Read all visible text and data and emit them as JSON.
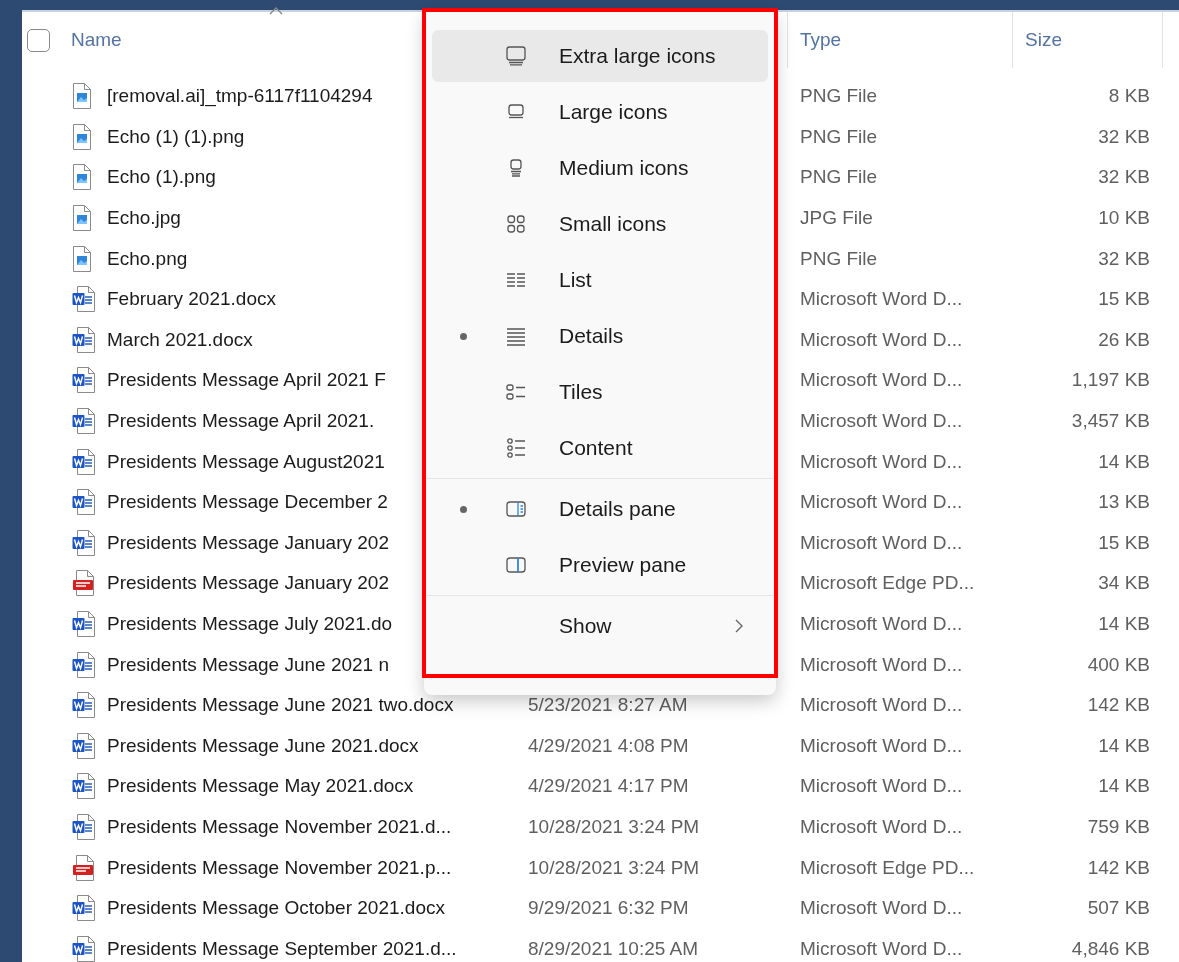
{
  "select_all": {
    "checked": false
  },
  "columns": [
    {
      "label": "Name",
      "sorted": true
    },
    {
      "label": "Type",
      "sorted": false
    },
    {
      "label": "Size",
      "sorted": false
    }
  ],
  "files": [
    {
      "name": "[removal.ai]_tmp-6117f1104294",
      "kind": "image",
      "type": "PNG File",
      "size": "8 KB"
    },
    {
      "name": "Echo (1) (1).png",
      "kind": "image",
      "type": "PNG File",
      "size": "32 KB"
    },
    {
      "name": "Echo (1).png",
      "kind": "image",
      "type": "PNG File",
      "size": "32 KB"
    },
    {
      "name": "Echo.jpg",
      "kind": "image",
      "type": "JPG File",
      "size": "10 KB"
    },
    {
      "name": "Echo.png",
      "kind": "image",
      "type": "PNG File",
      "size": "32 KB"
    },
    {
      "name": "February 2021.docx",
      "kind": "word",
      "type": "Microsoft Word D...",
      "size": "15 KB"
    },
    {
      "name": "March 2021.docx",
      "kind": "word",
      "type": "Microsoft Word D...",
      "size": "26 KB"
    },
    {
      "name": "Presidents Message April 2021 F",
      "kind": "word",
      "type": "Microsoft Word D...",
      "size": "1,197 KB"
    },
    {
      "name": "Presidents Message April 2021.",
      "kind": "word",
      "type": "Microsoft Word D...",
      "size": "3,457 KB"
    },
    {
      "name": "Presidents Message August2021",
      "kind": "word",
      "type": "Microsoft Word D...",
      "size": "14 KB"
    },
    {
      "name": "Presidents Message December 2",
      "kind": "word",
      "type": "Microsoft Word D...",
      "size": "13 KB"
    },
    {
      "name": "Presidents Message January 202",
      "kind": "word",
      "type": "Microsoft Word D...",
      "size": "15 KB"
    },
    {
      "name": "Presidents Message January 202",
      "kind": "pdf",
      "type": "Microsoft Edge PD...",
      "size": "34 KB"
    },
    {
      "name": "Presidents Message July 2021.do",
      "kind": "word",
      "type": "Microsoft Word D...",
      "size": "14 KB"
    },
    {
      "name": "Presidents Message June 2021 n",
      "kind": "word",
      "type": "Microsoft Word D...",
      "size": "400 KB"
    },
    {
      "name": "Presidents Message June 2021 two.docx",
      "kind": "word",
      "modified": "5/23/2021 8:27 AM",
      "type": "Microsoft Word D...",
      "size": "142 KB"
    },
    {
      "name": "Presidents Message June 2021.docx",
      "kind": "word",
      "modified": "4/29/2021 4:08 PM",
      "type": "Microsoft Word D...",
      "size": "14 KB"
    },
    {
      "name": "Presidents Message May 2021.docx",
      "kind": "word",
      "modified": "4/29/2021 4:17 PM",
      "type": "Microsoft Word D...",
      "size": "14 KB"
    },
    {
      "name": "Presidents Message November 2021.d...",
      "kind": "word",
      "modified": "10/28/2021 3:24 PM",
      "type": "Microsoft Word D...",
      "size": "759 KB"
    },
    {
      "name": "Presidents Message November 2021.p...",
      "kind": "pdf",
      "modified": "10/28/2021 3:24 PM",
      "type": "Microsoft Edge PD...",
      "size": "142 KB"
    },
    {
      "name": "Presidents Message October 2021.docx",
      "kind": "word",
      "modified": "9/29/2021 6:32 PM",
      "type": "Microsoft Word D...",
      "size": "507 KB"
    },
    {
      "name": "Presidents Message September 2021.d...",
      "kind": "word",
      "modified": "8/29/2021 10:25 AM",
      "type": "Microsoft Word D...",
      "size": "4,846 KB"
    }
  ],
  "view_menu": {
    "items": [
      {
        "label": "Extra large icons",
        "kind": "layout",
        "selected": false,
        "highlighted": true
      },
      {
        "label": "Large icons",
        "kind": "layout",
        "selected": false,
        "highlighted": false
      },
      {
        "label": "Medium icons",
        "kind": "layout",
        "selected": false,
        "highlighted": false
      },
      {
        "label": "Small icons",
        "kind": "layout",
        "selected": false,
        "highlighted": false
      },
      {
        "label": "List",
        "kind": "layout",
        "selected": false,
        "highlighted": false
      },
      {
        "label": "Details",
        "kind": "layout",
        "selected": true,
        "highlighted": false
      },
      {
        "label": "Tiles",
        "kind": "layout",
        "selected": false,
        "highlighted": false
      },
      {
        "label": "Content",
        "kind": "layout",
        "selected": false,
        "highlighted": false
      },
      {
        "label": "Details pane",
        "kind": "pane",
        "selected": true,
        "highlighted": false
      },
      {
        "label": "Preview pane",
        "kind": "pane",
        "selected": false,
        "highlighted": false
      },
      {
        "label": "Show",
        "kind": "submenu",
        "selected": false,
        "highlighted": false
      }
    ]
  }
}
